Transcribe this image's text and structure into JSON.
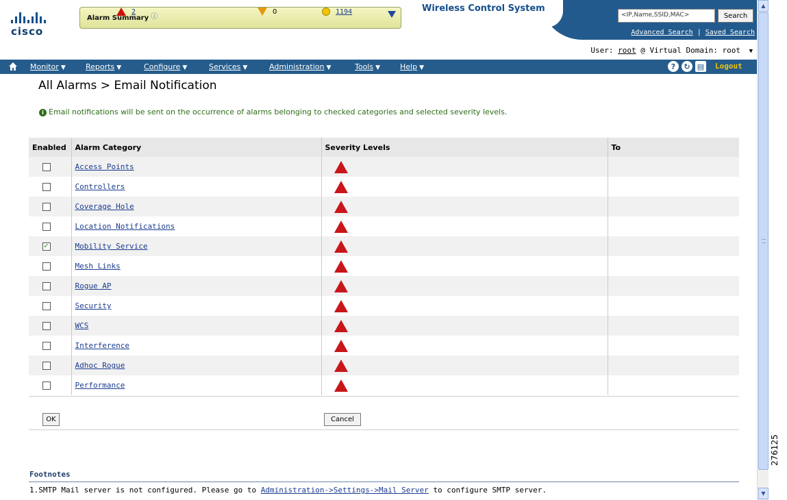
{
  "header": {
    "brand_word": "cisco",
    "product_name": "Wireless Control System",
    "alarm_summary": {
      "title": "Alarm Summary",
      "critical_count": "2",
      "major_count": "0",
      "minor_count": "1194"
    },
    "search": {
      "placeholder": "<IP,Name,SSID,MAC>",
      "button_label": "Search",
      "advanced_label": "Advanced Search",
      "separator": "|",
      "saved_label": "Saved Search"
    },
    "user": {
      "prefix": "User:",
      "name": "root",
      "domain_prefix": "@ Virtual Domain:",
      "domain": "root"
    }
  },
  "nav": {
    "items": [
      "Monitor",
      "Reports",
      "Configure",
      "Services",
      "Administration",
      "Tools",
      "Help"
    ],
    "logout_label": "Logout"
  },
  "page": {
    "breadcrumb": "All Alarms > Email Notification",
    "info_text": "Email notifications will be sent on the occurrence of alarms belonging to checked categories and selected severity levels."
  },
  "table": {
    "headers": {
      "enabled": "Enabled",
      "category": "Alarm Category",
      "severity": "Severity Levels",
      "to": "To"
    },
    "rows": [
      {
        "category": "Access Points",
        "enabled": false,
        "to": ""
      },
      {
        "category": "Controllers",
        "enabled": false,
        "to": ""
      },
      {
        "category": "Coverage Hole",
        "enabled": false,
        "to": ""
      },
      {
        "category": "Location Notifications",
        "enabled": false,
        "to": ""
      },
      {
        "category": "Mobility Service",
        "enabled": true,
        "to": ""
      },
      {
        "category": "Mesh Links",
        "enabled": false,
        "to": ""
      },
      {
        "category": "Rogue AP",
        "enabled": false,
        "to": ""
      },
      {
        "category": "Security",
        "enabled": false,
        "to": ""
      },
      {
        "category": "WCS",
        "enabled": false,
        "to": ""
      },
      {
        "category": "Interference",
        "enabled": false,
        "to": ""
      },
      {
        "category": "Adhoc Rogue",
        "enabled": false,
        "to": ""
      },
      {
        "category": "Performance",
        "enabled": false,
        "to": ""
      }
    ]
  },
  "buttons": {
    "ok_label": "OK",
    "cancel_label": "Cancel"
  },
  "footnotes": {
    "title": "Footnotes",
    "note_prefix": "1.SMTP Mail server is not configured. Please go to",
    "note_link": "Administration->Settings->Mail Server",
    "note_suffix": "to configure SMTP server."
  },
  "figure_id": "276125",
  "colors": {
    "navbar": "#255c8c",
    "link": "#1a3b8e",
    "info_green": "#2d6d18",
    "critical_red": "#c8161b"
  }
}
